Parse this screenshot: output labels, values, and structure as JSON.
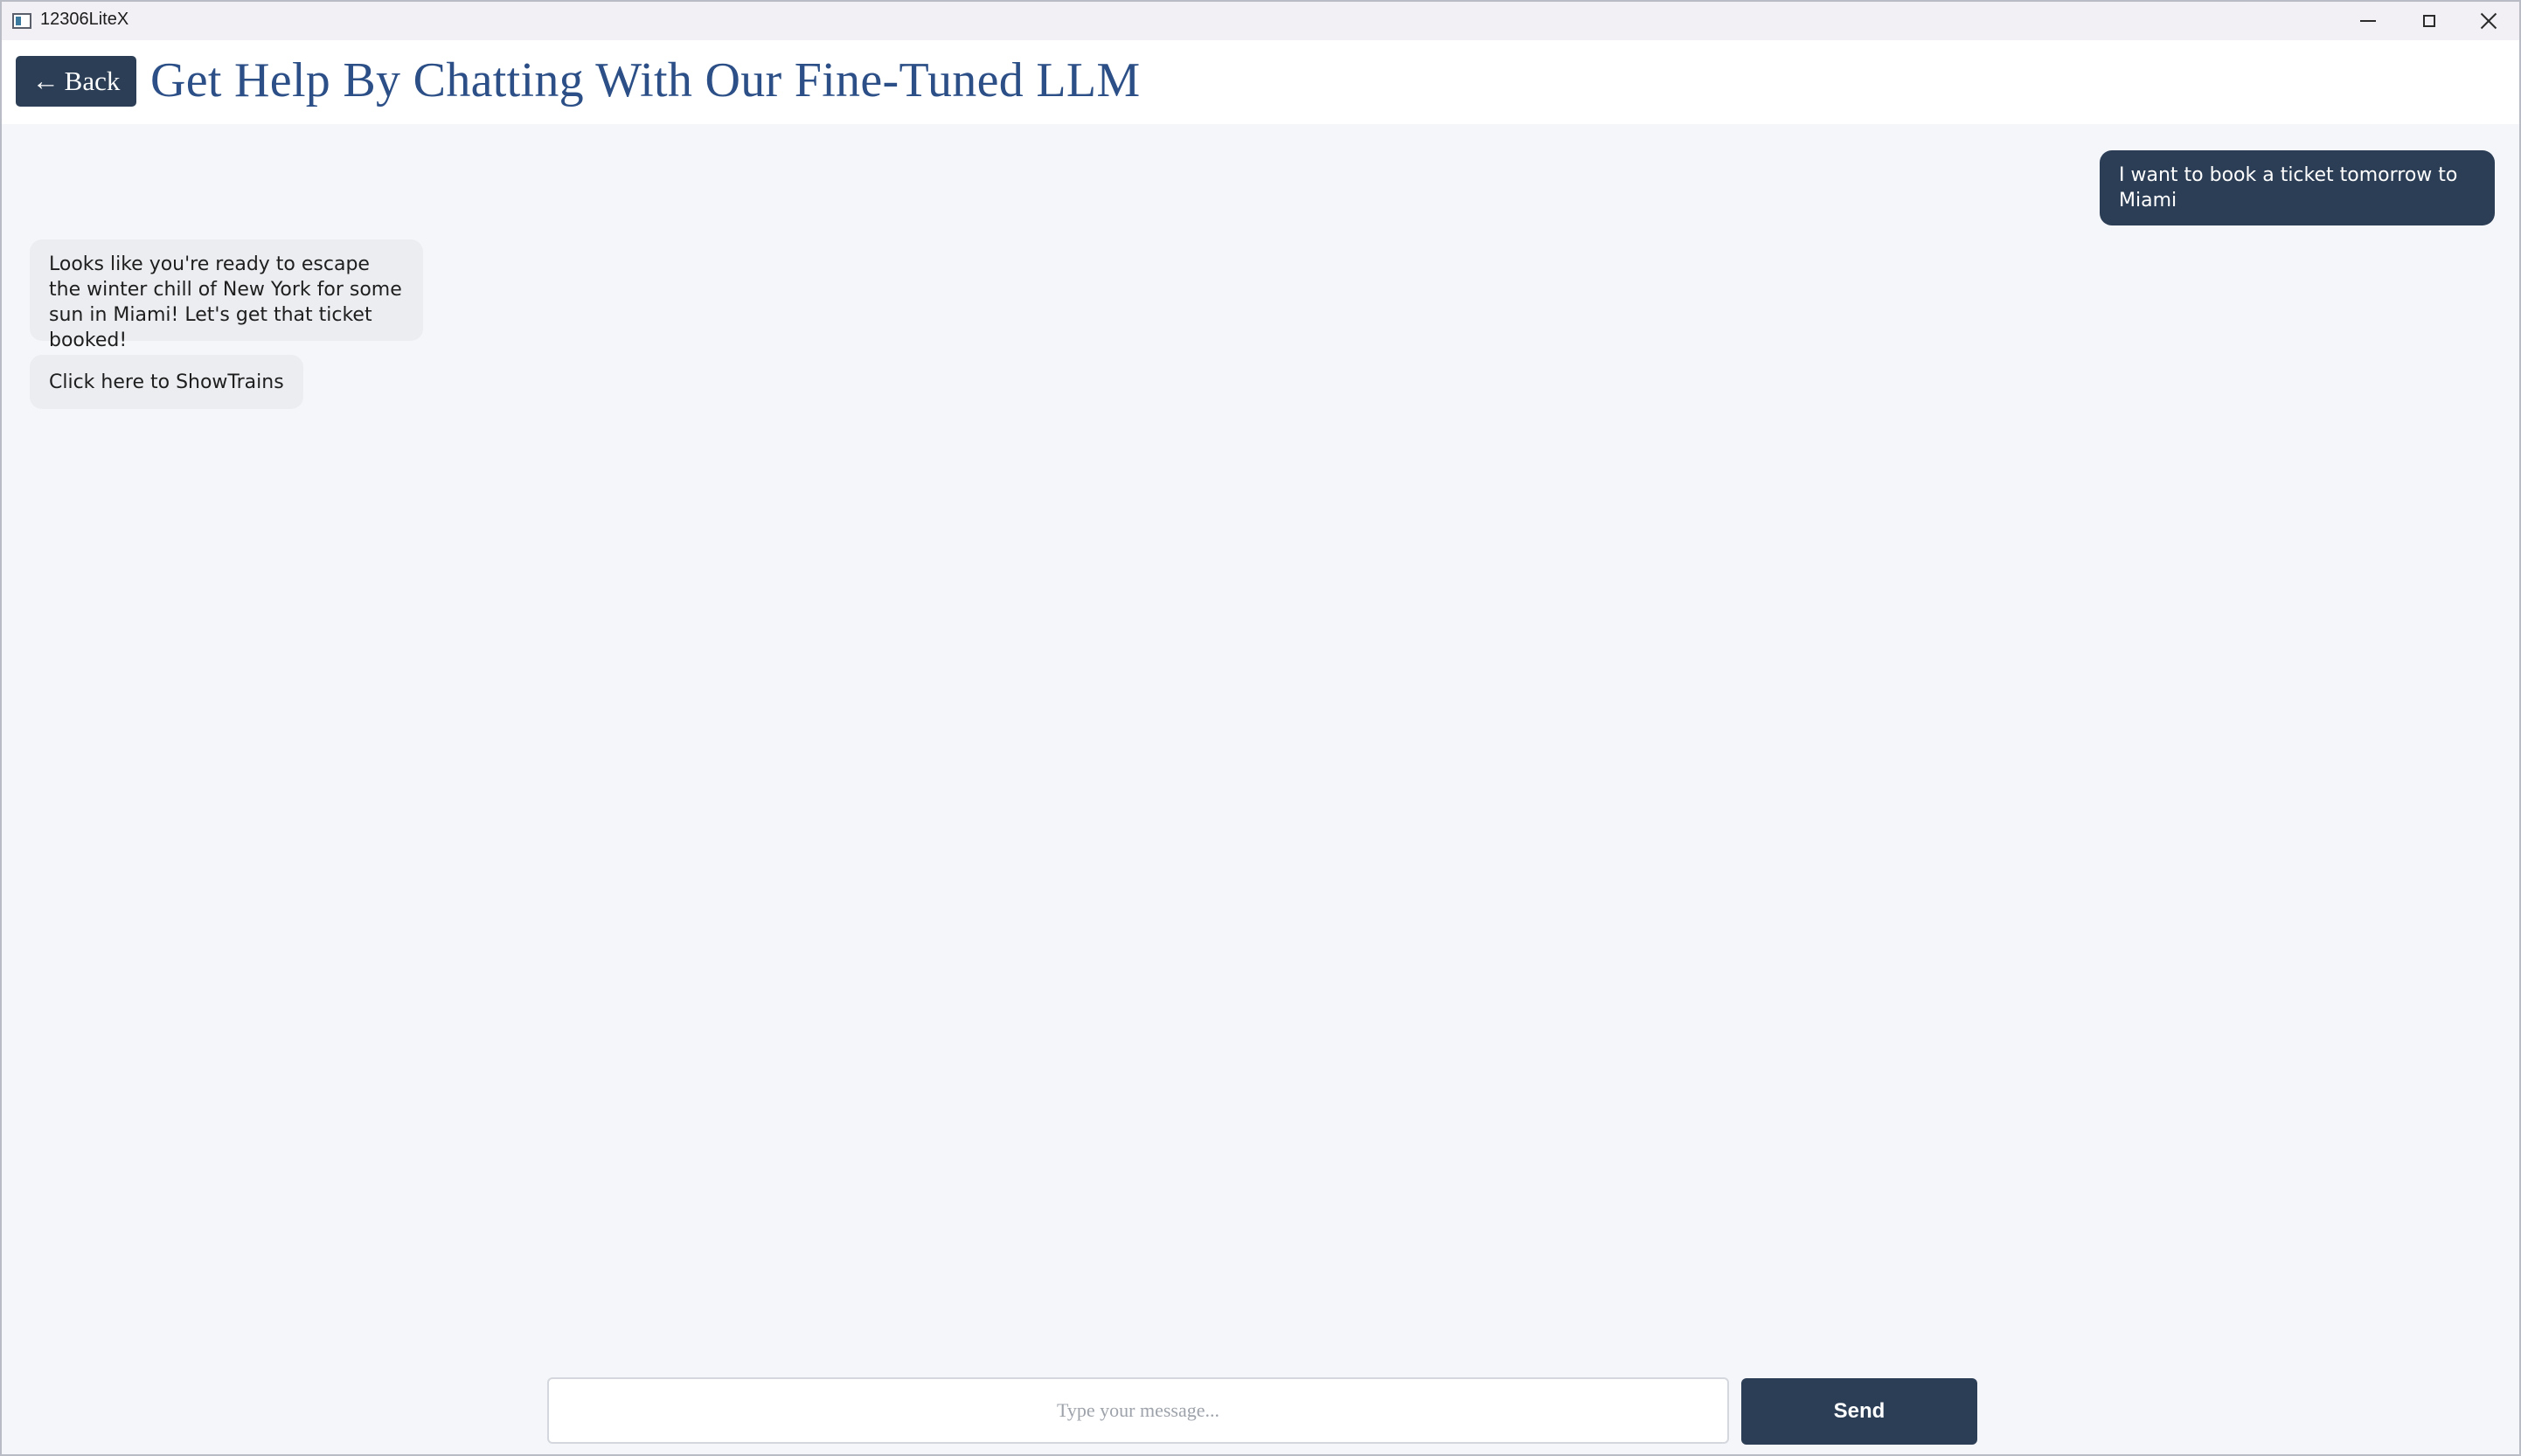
{
  "window": {
    "title": "12306LiteX",
    "controls": {
      "minimize_icon": "minimize-icon",
      "maximize_icon": "maximize-icon",
      "close_icon": "close-icon"
    }
  },
  "header": {
    "back_arrow": "←",
    "back_label": "Back",
    "title": "Get Help By Chatting With Our Fine-Tuned LLM"
  },
  "chat": {
    "messages": [
      {
        "role": "user",
        "text": "I want to book a ticket tomorrow to Miami"
      },
      {
        "role": "assistant",
        "text": "Looks like you're ready to escape the winter chill of New York for some sun in Miami! Let's get that ticket booked!"
      },
      {
        "role": "assistant-action",
        "text": "Click here to ShowTrains"
      }
    ]
  },
  "composer": {
    "placeholder": "Type your message...",
    "value": "",
    "send_label": "Send"
  },
  "colors": {
    "accent": "#2c3e55",
    "title": "#2b4f86",
    "background": "#f5f6f9",
    "bot_bubble": "#ebedf1"
  }
}
